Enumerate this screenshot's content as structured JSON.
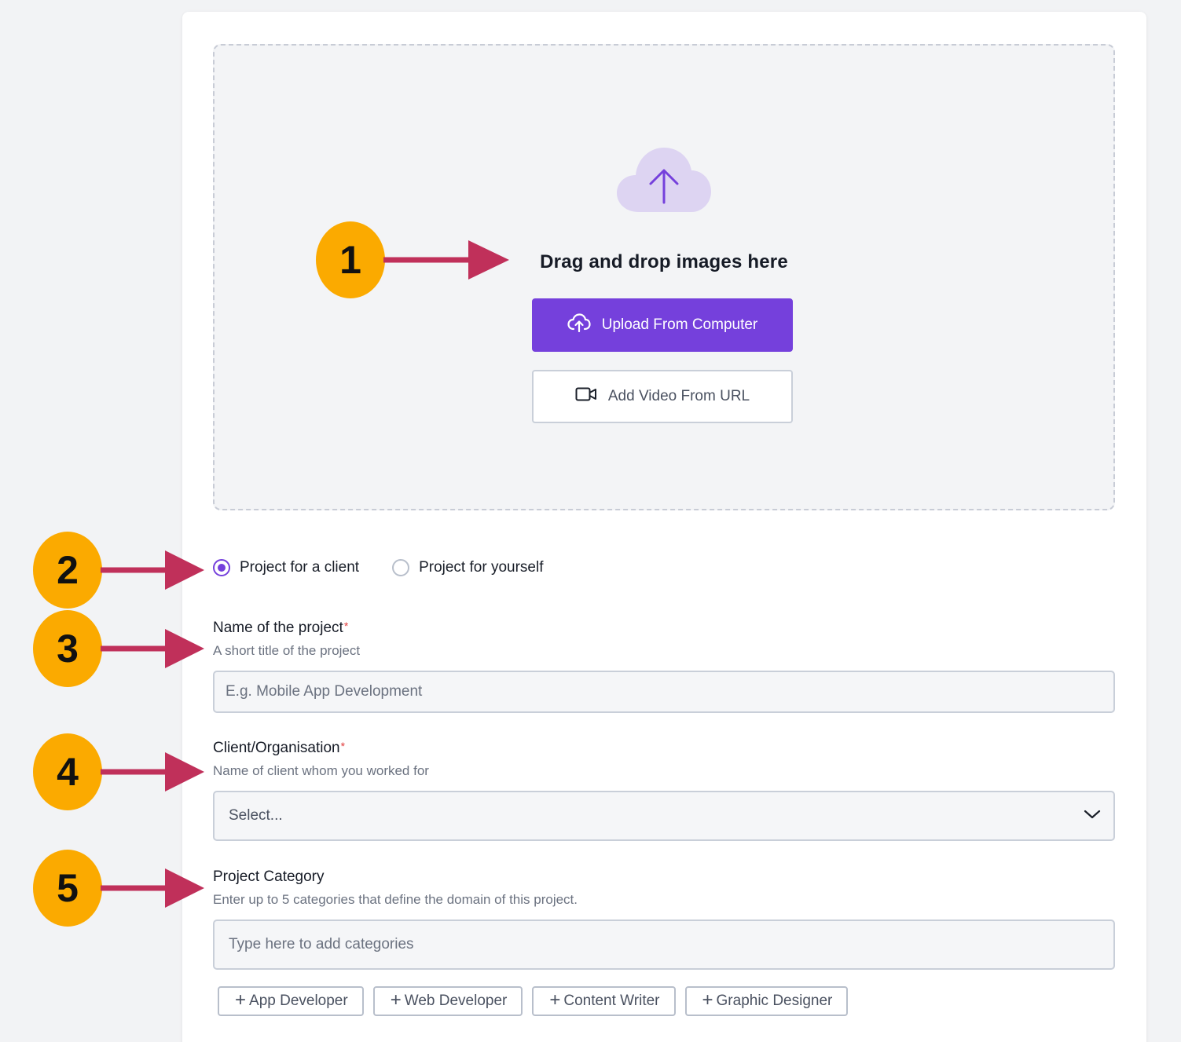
{
  "dropzone": {
    "title": "Drag and drop images here",
    "upload_label": "Upload From Computer",
    "video_label": "Add Video From URL"
  },
  "project_type": {
    "options": [
      {
        "label": "Project for a client",
        "selected": true
      },
      {
        "label": "Project for yourself",
        "selected": false
      }
    ]
  },
  "project_name": {
    "label": "Name of the project",
    "required_mark": "*",
    "hint": "A short title of the project",
    "placeholder": "E.g. Mobile App Development",
    "value": ""
  },
  "client": {
    "label": "Client/Organisation",
    "required_mark": "*",
    "hint": "Name of client whom you worked for",
    "selected": "Select..."
  },
  "category": {
    "label": "Project Category",
    "hint": "Enter up to 5 categories that define the domain of this project.",
    "placeholder": "Type here to add categories",
    "value": "",
    "suggestions": [
      "App Developer",
      "Web Developer",
      "Content Writer",
      "Graphic Designer"
    ]
  },
  "annotations": {
    "markers": [
      "1",
      "2",
      "3",
      "4",
      "5"
    ]
  },
  "colors": {
    "accent": "#7540dc",
    "marker": "#fbaa00",
    "arrow": "#c0305a",
    "required": "#e03a3a"
  },
  "icons": {
    "dropzone": "cloud-upload-icon",
    "upload_button": "cloud-upload-small-icon",
    "video_button": "video-camera-icon",
    "select_caret": "chevron-down-icon",
    "chip": "plus-icon"
  }
}
